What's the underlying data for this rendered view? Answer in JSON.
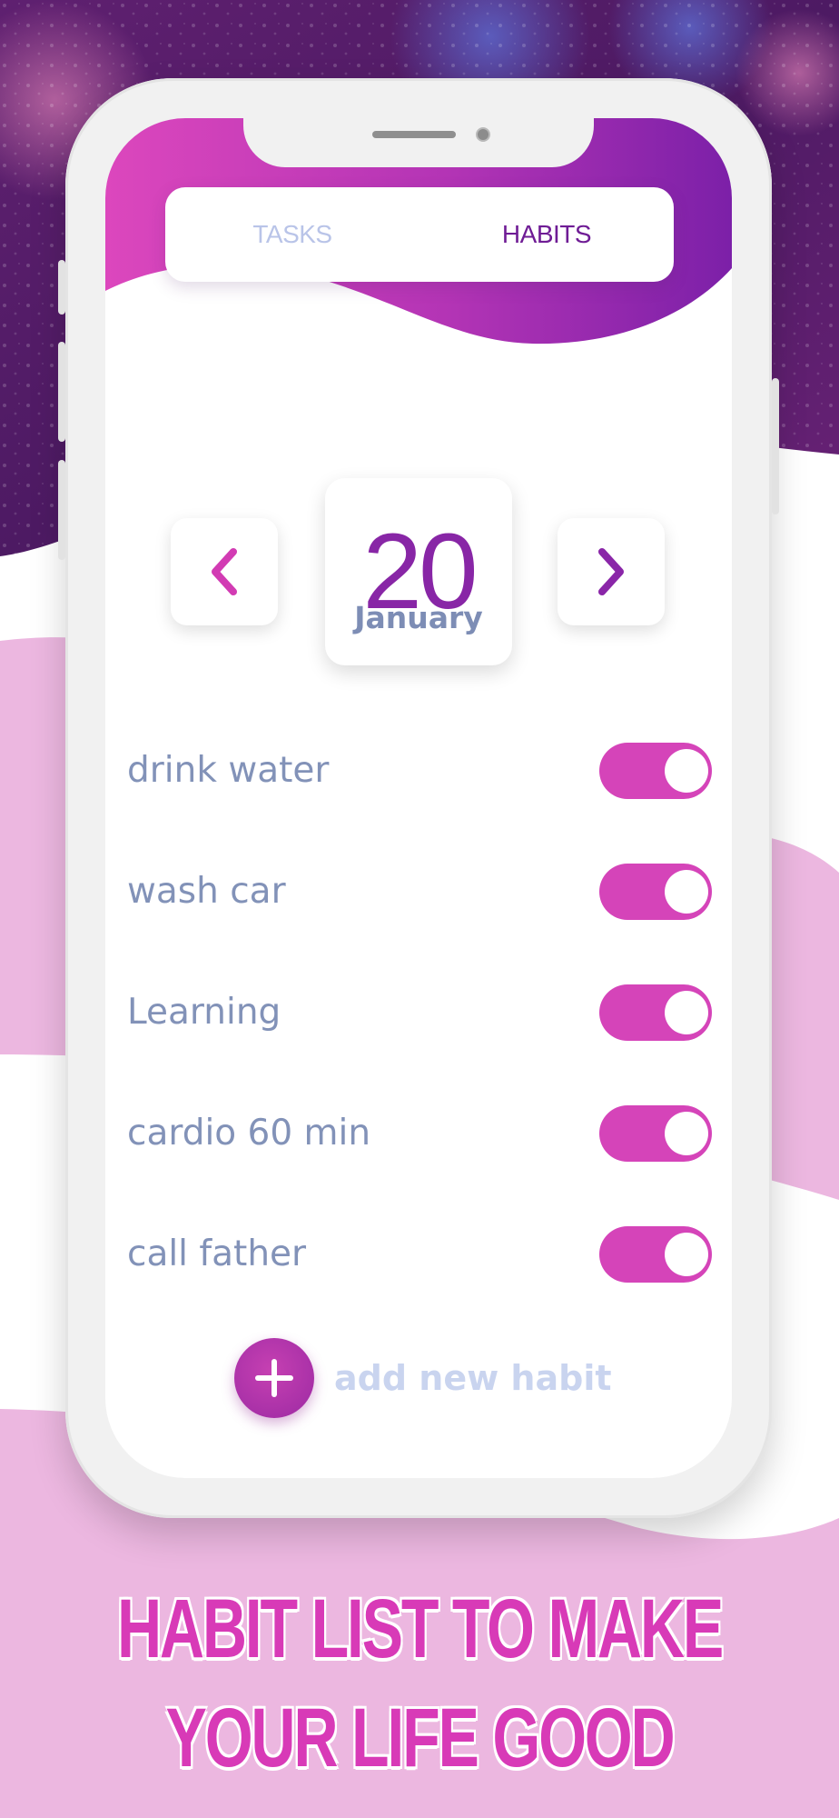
{
  "tabs": [
    {
      "label": "TASKS",
      "active": false
    },
    {
      "label": "HABITS",
      "active": true
    }
  ],
  "date": {
    "day": "20",
    "month": "January"
  },
  "habits": [
    {
      "name": "drink water",
      "enabled": true
    },
    {
      "name": "wash car",
      "enabled": true
    },
    {
      "name": "Learning",
      "enabled": true
    },
    {
      "name": "cardio 60 min",
      "enabled": true
    },
    {
      "name": "call father",
      "enabled": true
    }
  ],
  "add_habit": {
    "label": "add new habit"
  },
  "headline": {
    "line1": "HABIT LIST TO MAKE",
    "line2": "YOUR LIFE GOOD"
  },
  "colors": {
    "accent": "#d544b9",
    "purple": "#8826a6",
    "muted_text": "#8292b8",
    "tab_inactive": "#b9c4e8",
    "pink_bg": "#ecb7e0"
  },
  "icons": {
    "prev": "chevron-left-icon",
    "next": "chevron-right-icon",
    "add": "plus-icon"
  }
}
